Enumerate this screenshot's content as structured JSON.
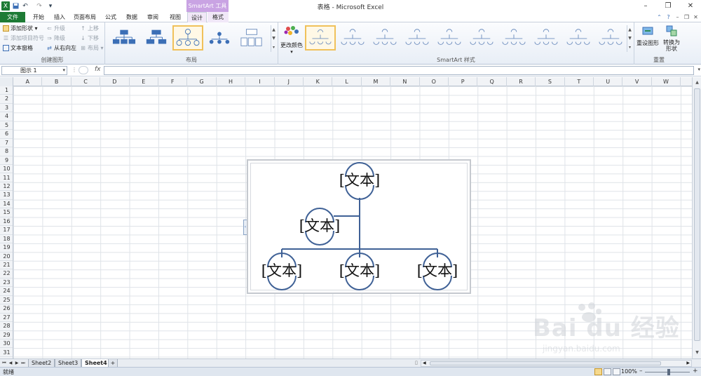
{
  "window": {
    "title": "表格 - Microsoft Excel",
    "contextual_tab_group": "SmartArt 工具"
  },
  "tabs": [
    {
      "label": "文件",
      "kind": "file"
    },
    {
      "label": "开始"
    },
    {
      "label": "插入"
    },
    {
      "label": "页面布局"
    },
    {
      "label": "公式"
    },
    {
      "label": "数据"
    },
    {
      "label": "审阅"
    },
    {
      "label": "视图"
    },
    {
      "label": "设计",
      "active": true
    },
    {
      "label": "格式"
    }
  ],
  "ribbon": {
    "create": {
      "label": "创建图形",
      "add_shape": "添加形状",
      "add_bullet": "添加项目符号",
      "text_pane": "文本窗格",
      "promote": "升级",
      "demote": "降级",
      "right_to_left": "从右向左",
      "move_up": "上移",
      "move_down": "下移",
      "layout_cmd": "布局"
    },
    "layouts": {
      "label": "布局"
    },
    "styles": {
      "label": "SmartArt 样式",
      "change_colors": "更改颜色"
    },
    "reset": {
      "label": "重置",
      "reset_graphic": "重设图形",
      "convert_line1": "转换为",
      "convert_line2": "形状"
    }
  },
  "formula_bar": {
    "name_box": "图示 1",
    "fx": "fx",
    "value": ""
  },
  "columns": [
    "A",
    "B",
    "C",
    "D",
    "E",
    "F",
    "G",
    "H",
    "I",
    "J",
    "K",
    "L",
    "M",
    "N",
    "O",
    "P",
    "Q",
    "R",
    "S",
    "T",
    "U",
    "V",
    "W"
  ],
  "rows": [
    "1",
    "2",
    "3",
    "4",
    "5",
    "6",
    "7",
    "8",
    "9",
    "10",
    "11",
    "12",
    "13",
    "14",
    "15",
    "16",
    "17",
    "18",
    "19",
    "20",
    "21",
    "22",
    "23",
    "24",
    "25",
    "26",
    "27",
    "28",
    "29",
    "30",
    "31"
  ],
  "smartart": {
    "nodes": [
      {
        "text": "[文本]"
      },
      {
        "text": "[文本]"
      },
      {
        "text": "[文本]"
      },
      {
        "text": "[文本]"
      },
      {
        "text": "[文本]"
      }
    ],
    "line_color": "#3f6196"
  },
  "sheets": [
    {
      "name": "Sheet2"
    },
    {
      "name": "Sheet3"
    },
    {
      "name": "Sheet4",
      "active": true
    }
  ],
  "status": {
    "ready": "就绪",
    "zoom": "100%"
  },
  "watermark": {
    "brand": "Bai du 经验",
    "url": "jingyan.baidu.com"
  }
}
